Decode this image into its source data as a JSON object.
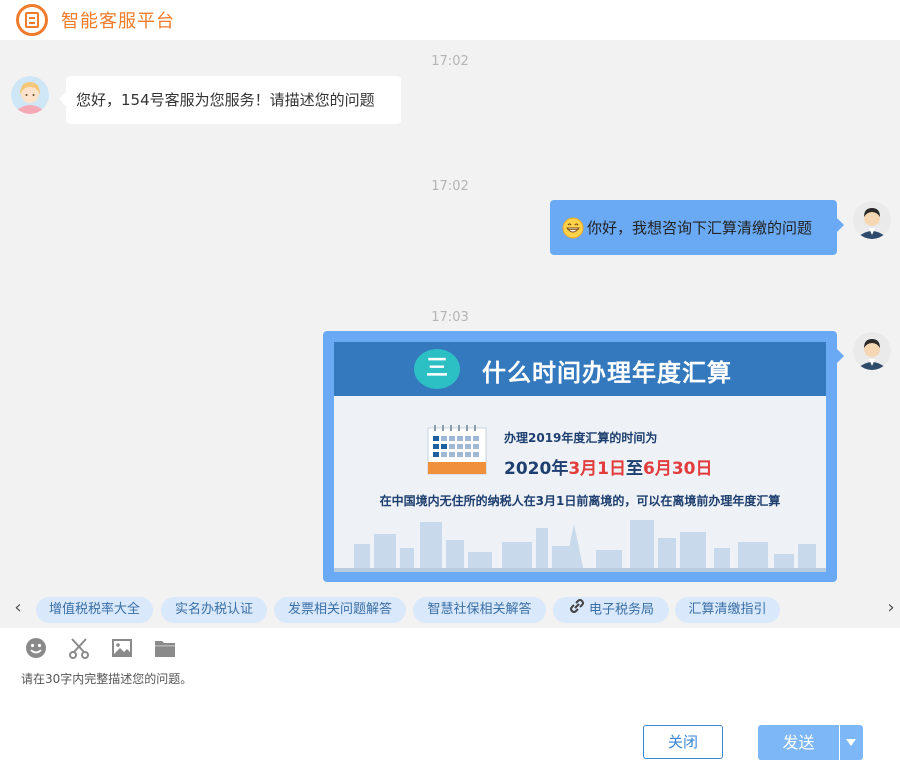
{
  "header": {
    "title": "智能客服平台",
    "logo_icon": "service-platform-logo"
  },
  "chat": {
    "messages": [
      {
        "time": "17:02",
        "from": "agent",
        "text": "您好，154号客服为您服务！请描述您的问题"
      },
      {
        "time": "17:02",
        "from": "user",
        "text": "你好，我想咨询下汇算清缴的问题",
        "emoji": "grin-emoji"
      },
      {
        "time": "17:03",
        "from": "user",
        "type": "image"
      }
    ],
    "poster": {
      "badge": "三",
      "title": "什么时间办理年度汇算",
      "line1": "办理2019年度汇算的时间为",
      "date_prefix": "2020年",
      "date_start": "3月1日",
      "date_mid": "至",
      "date_end": "6月30日",
      "line3": "在中国境内无住所的纳税人在3月1日前离境的，可以在离境前办理年度汇算"
    }
  },
  "quick_links": {
    "prev_label": "‹",
    "next_label": "›",
    "items": [
      {
        "label": "增值税税率大全"
      },
      {
        "label": "实名办税认证"
      },
      {
        "label": "发票相关问题解答"
      },
      {
        "label": "智慧社保相关解答"
      },
      {
        "label": "电子税务局",
        "icon": "link-icon"
      },
      {
        "label": "汇算清缴指引"
      }
    ]
  },
  "toolbar": {
    "tools": [
      "emoji-icon",
      "scissors-icon",
      "image-icon",
      "folder-icon"
    ]
  },
  "input": {
    "placeholder": "请在30字内完整描述您的问题。"
  },
  "actions": {
    "close_label": "关闭",
    "send_label": "发送"
  },
  "colors": {
    "accent": "#f07b2a",
    "user_bubble": "#6aaaf5",
    "chip_bg": "#d9e8fb",
    "poster_header": "#3478bd",
    "highlight": "#e23c3c"
  }
}
